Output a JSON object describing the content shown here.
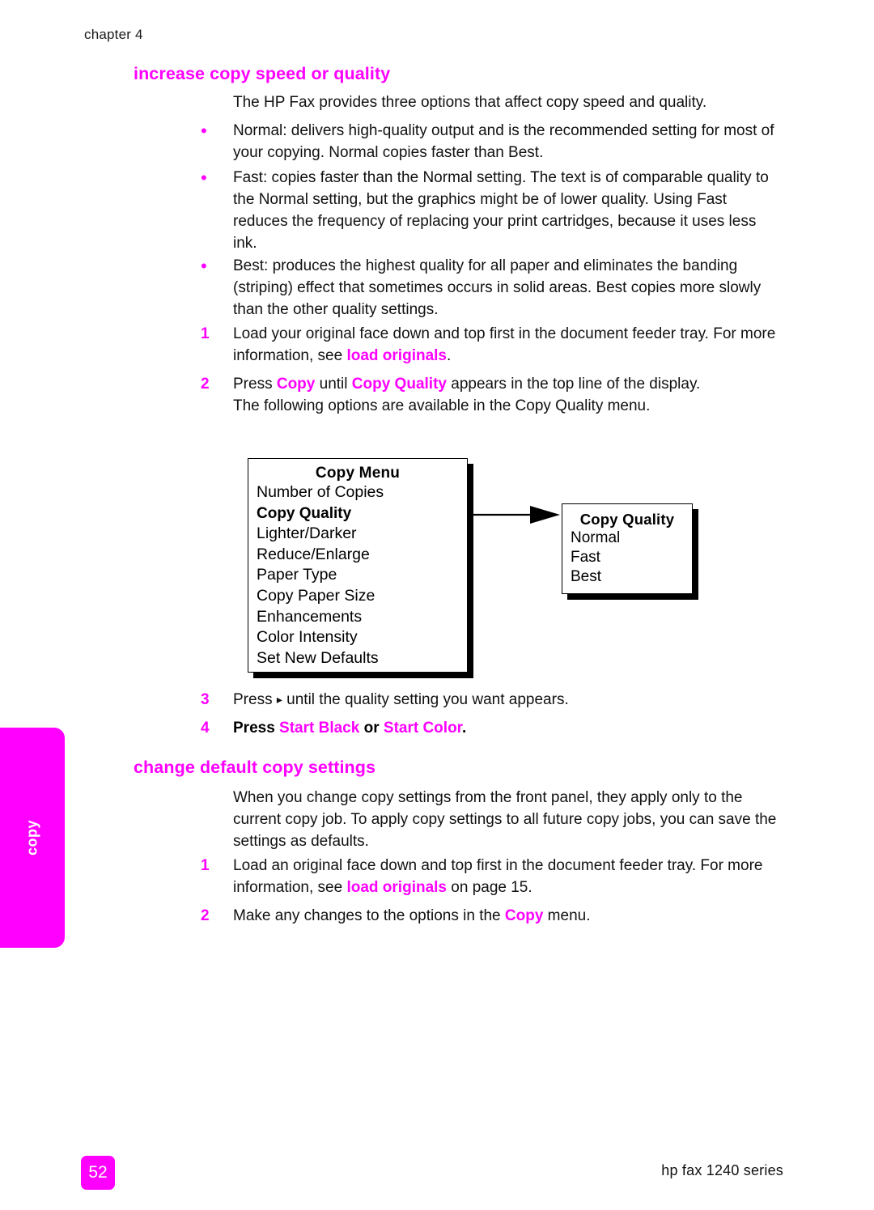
{
  "page": {
    "chapter_label": "chapter 4",
    "page_number": "52",
    "product_footer": "hp fax 1240 series",
    "side_tab_label": "copy",
    "accent_color": "#ff00ff",
    "text_color": "#111111"
  },
  "sections": [
    {
      "heading": "increase copy speed or quality",
      "intro": "The HP Fax provides three options that affect copy speed and quality.",
      "bullets": [
        {
          "marker": "•",
          "lead": "Normal:",
          "text": "Normal: delivers high-quality output and is the recommended setting for most of your copying. Normal copies faster than Best."
        },
        {
          "marker": "•",
          "lead": "Fast:",
          "text": "Fast: copies faster than the Normal setting. The text is of comparable quality to the Normal setting, but the graphics might be of lower quality. Using Fast reduces the frequency of replacing your print cartridges, because it uses less ink."
        },
        {
          "marker": "•",
          "lead": "Best:",
          "text": "Best: produces the highest quality for all paper and eliminates the banding (striping) effect that sometimes occurs in solid areas. Best copies more slowly than the other quality settings."
        }
      ],
      "steps_before_diagram": [
        {
          "number": "1",
          "text_part1": "Load your original face down and top first in the document feeder tray. For more information, see ",
          "link": "load originals",
          "text_part2": "."
        },
        {
          "number": "2",
          "text_part1": "Press ",
          "bold1": "Copy",
          "text_part2": " until ",
          "bold2": "Copy Quality",
          "text_part3": " appears in the top line of the display.",
          "subtext": "The following options are available in the Copy Quality menu."
        }
      ],
      "steps_after_diagram": [
        {
          "number": "3",
          "text_part1": "Press ",
          "glyph": "▸",
          "text_part2": " until the quality setting you want appears."
        },
        {
          "number": "4",
          "text_part1": "Press ",
          "bold1": "Start Black",
          "text_part2": " or ",
          "bold2": "Start Color",
          "text_part3": "."
        }
      ]
    },
    {
      "heading": "change default copy settings",
      "intro": "When you change copy settings from the front panel, they apply only to the current copy job. To apply copy settings to all future copy jobs, you can save the settings as defaults.",
      "steps": [
        {
          "number": "1",
          "text_part1": "Load an original face down and top first in the document feeder tray. For more information, see ",
          "link": "load originals",
          "text_part2": " on page 15."
        },
        {
          "number": "2",
          "text_part1": "Make any changes to the options in the ",
          "bold1": "Copy",
          "text_part2": " menu."
        }
      ]
    }
  ],
  "diagram": {
    "copy_menu": {
      "title": "Copy Menu",
      "items": [
        "Number of Copies",
        "Copy Quality",
        "Lighter/Darker",
        "Reduce/Enlarge",
        "Paper Type",
        "Copy Paper Size",
        "Enhancements",
        "Color Intensity",
        "Set New Defaults"
      ],
      "highlighted_item": "Copy Quality"
    },
    "copy_quality": {
      "title": "Copy Quality",
      "items": [
        "Normal",
        "Fast",
        "Best"
      ]
    },
    "connector": "arrow-right"
  }
}
